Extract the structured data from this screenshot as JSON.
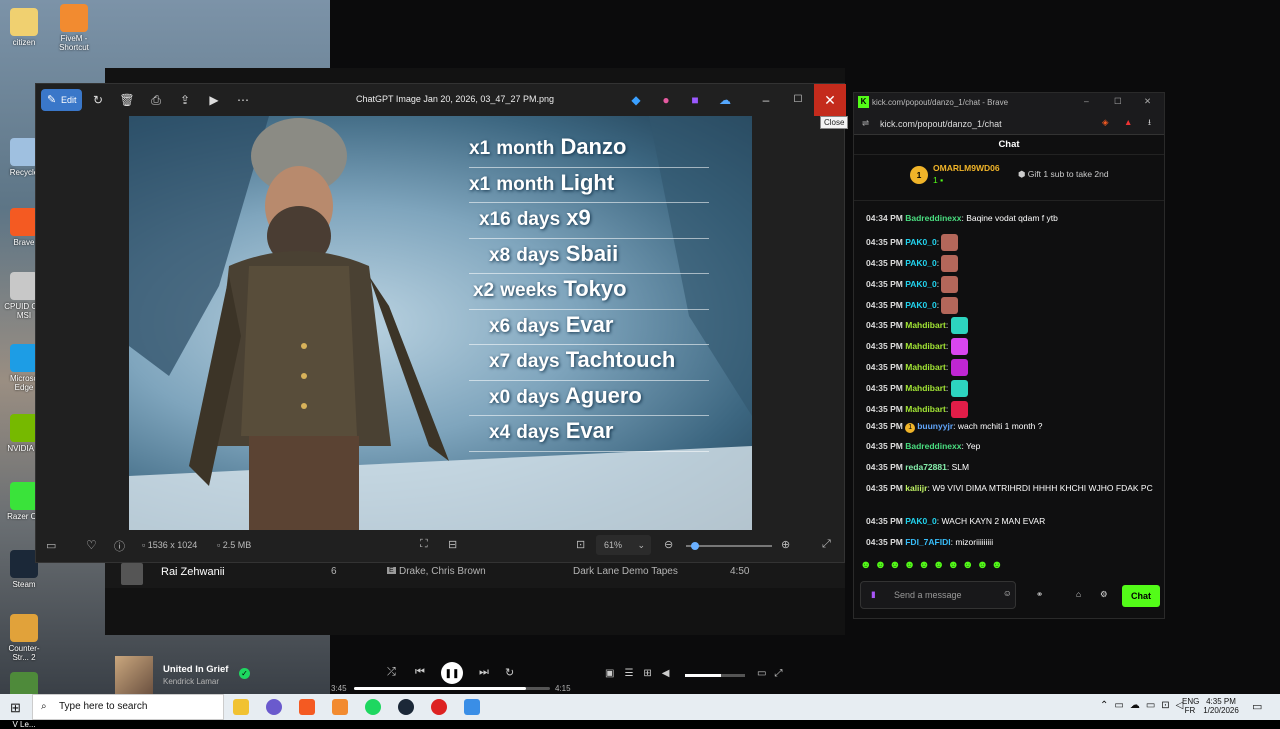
{
  "desktop": {
    "icons": [
      {
        "label": "citizen",
        "color": "#f0d070"
      },
      {
        "label": "FiveM - Shortcut",
        "color": "#f28b30"
      },
      {
        "label": "Recycle",
        "color": "#9fc0e0"
      },
      {
        "label": "Brave",
        "color": "#f45a22"
      },
      {
        "label": "CPUID C... MSI",
        "color": "#c8c8c8"
      },
      {
        "label": "Microso Edge",
        "color": "#1d9de5"
      },
      {
        "label": "NVIDIA A",
        "color": "#76b900"
      },
      {
        "label": "Razer Co",
        "color": "#3ae33a"
      },
      {
        "label": "Steam",
        "color": "#1b2838"
      },
      {
        "label": "Counter-Str... 2",
        "color": "#e1a23a"
      },
      {
        "label": "Grand Theft Auto V Le...",
        "color": "#4e8a3a"
      }
    ]
  },
  "spotify": {
    "row": {
      "artist_name": "Rai Zehwanii",
      "index": "6",
      "badge": "E",
      "artists": "Drake, Chris Brown",
      "album": "Dark Lane Demo Tapes",
      "duration": "4:50"
    },
    "now_playing": {
      "title": "United In Grief",
      "artist": "Kendrick Lamar",
      "elapsed": "3:45",
      "total": "4:15",
      "progress": 0.88,
      "volume": 0.6
    }
  },
  "photos": {
    "edit_label": "Edit",
    "filename": "ChatGPT Image Jan 20, 2026, 03_47_27 PM.png",
    "close_tooltip": "Close",
    "image_list": [
      {
        "count": "x1",
        "period": "month",
        "name": "Danzo"
      },
      {
        "count": "x1",
        "period": "month",
        "name": "Light"
      },
      {
        "count": "x16",
        "period": "days",
        "name": "x9"
      },
      {
        "count": "x8",
        "period": "days",
        "name": "Sbaii"
      },
      {
        "count": "x2",
        "period": "weeks",
        "name": "Tokyo"
      },
      {
        "count": "x6",
        "period": "days",
        "name": "Evar"
      },
      {
        "count": "x7",
        "period": "days",
        "name": "Tachtouch"
      },
      {
        "count": "x0",
        "period": "days",
        "name": "Aguero"
      },
      {
        "count": "x4",
        "period": "days",
        "name": "Evar"
      }
    ],
    "dimensions": "1536 x 1024",
    "filesize": "2.5 MB",
    "zoom": "61%",
    "zoom_level": 0.1
  },
  "chat": {
    "window_title": "kick.com/popout/danzo_1/chat - Brave",
    "url": "kick.com/popout/danzo_1/chat",
    "header": "Chat",
    "pinned": {
      "user": "OMARLM9WD06",
      "count": "1",
      "gift_text": "Gift 1 sub to take 2nd",
      "rank": "1"
    },
    "messages": [
      {
        "time": "04:34 PM",
        "user": "Badreddinexx",
        "color": "#4ade80",
        "text": "Baqine vodat qdam f ytb",
        "emote": ""
      },
      {
        "time": "04:35 PM",
        "user": "PAK0_0",
        "color": "#22d3ee",
        "text": "",
        "emote": "#b4675a"
      },
      {
        "time": "04:35 PM",
        "user": "PAK0_0",
        "color": "#22d3ee",
        "text": "",
        "emote": "#b4675a"
      },
      {
        "time": "04:35 PM",
        "user": "PAK0_0",
        "color": "#22d3ee",
        "text": "",
        "emote": "#b4675a"
      },
      {
        "time": "04:35 PM",
        "user": "PAK0_0",
        "color": "#22d3ee",
        "text": "",
        "emote": "#b4675a"
      },
      {
        "time": "04:35 PM",
        "user": "Mahdibart",
        "color": "#a3e635",
        "text": "",
        "emote": "#2dd4bf"
      },
      {
        "time": "04:35 PM",
        "user": "Mahdibart",
        "color": "#a3e635",
        "text": "",
        "emote": "#d946ef"
      },
      {
        "time": "04:35 PM",
        "user": "Mahdibart",
        "color": "#a3e635",
        "text": "",
        "emote": "#c026d3"
      },
      {
        "time": "04:35 PM",
        "user": "Mahdibart",
        "color": "#a3e635",
        "text": "",
        "emote": "#2dd4bf"
      },
      {
        "time": "04:35 PM",
        "user": "Mahdibart",
        "color": "#a3e635",
        "text": "",
        "emote": "#e11d48"
      },
      {
        "time": "04:35 PM",
        "user": "buunyyjr",
        "color": "#60a5fa",
        "text": "wach mchiti 1 month ?",
        "emote": ""
      },
      {
        "time": "04:35 PM",
        "user": "Badreddinexx",
        "color": "#4ade80",
        "text": "Yep",
        "emote": ""
      },
      {
        "time": "04:35 PM",
        "user": "reda72881",
        "color": "#86efac",
        "text": "SLM",
        "emote": ""
      },
      {
        "time": "04:35 PM",
        "user": "kaliijr",
        "color": "#bef264",
        "text": "W9 VIVI DIMA MTRIHRDI HHHH KHCHI WJHO FDAK PC",
        "emote": ""
      },
      {
        "time": "04:35 PM",
        "user": "PAK0_0",
        "color": "#22d3ee",
        "text": "WACH KAYN 2 MAN EVAR",
        "emote": ""
      },
      {
        "time": "04:35 PM",
        "user": "FDI_7AFIDI",
        "color": "#38bdf8",
        "text": "mizoriiiiiiiii",
        "emote": ""
      }
    ],
    "input_placeholder": "Send a message",
    "send_label": "Chat"
  },
  "taskbar": {
    "search_placeholder": "Type here to search",
    "lang": "ENG",
    "region": "FR",
    "time": "4:35 PM",
    "date": "1/20/2026"
  }
}
